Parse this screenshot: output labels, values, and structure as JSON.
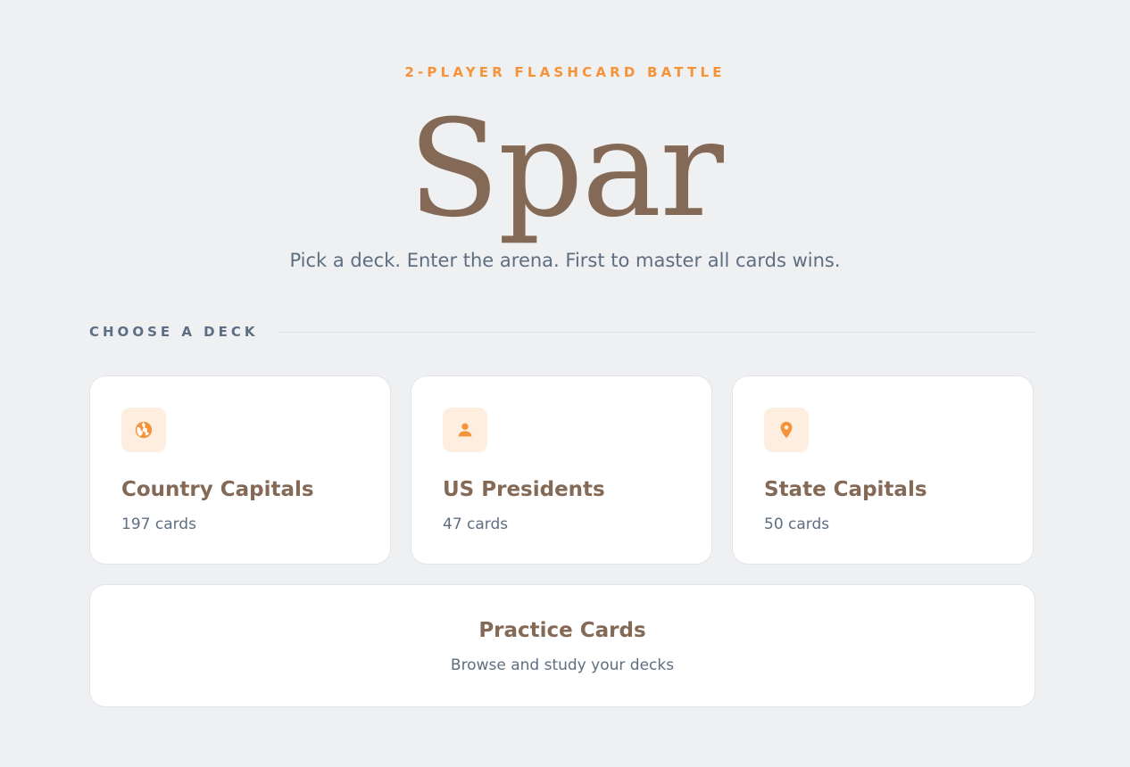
{
  "hero": {
    "eyebrow": "2-PLAYER FLASHCARD BATTLE",
    "title": "Spar",
    "subtitle": "Pick a deck. Enter the arena. First to master all cards wins."
  },
  "section": {
    "label": "CHOOSE A DECK"
  },
  "decks": [
    {
      "title": "Country Capitals",
      "count": "197 cards",
      "icon": "globe-icon"
    },
    {
      "title": "US Presidents",
      "count": "47 cards",
      "icon": "person-icon"
    },
    {
      "title": "State Capitals",
      "count": "50 cards",
      "icon": "map-pin-icon"
    }
  ],
  "practice": {
    "title": "Practice Cards",
    "subtitle": "Browse and study your decks"
  },
  "colors": {
    "accent": "#f4933a",
    "title_brown": "#846a56",
    "muted_text": "#5e6e82",
    "icon_bg": "#fdeee0",
    "background": "#eff0f2"
  }
}
